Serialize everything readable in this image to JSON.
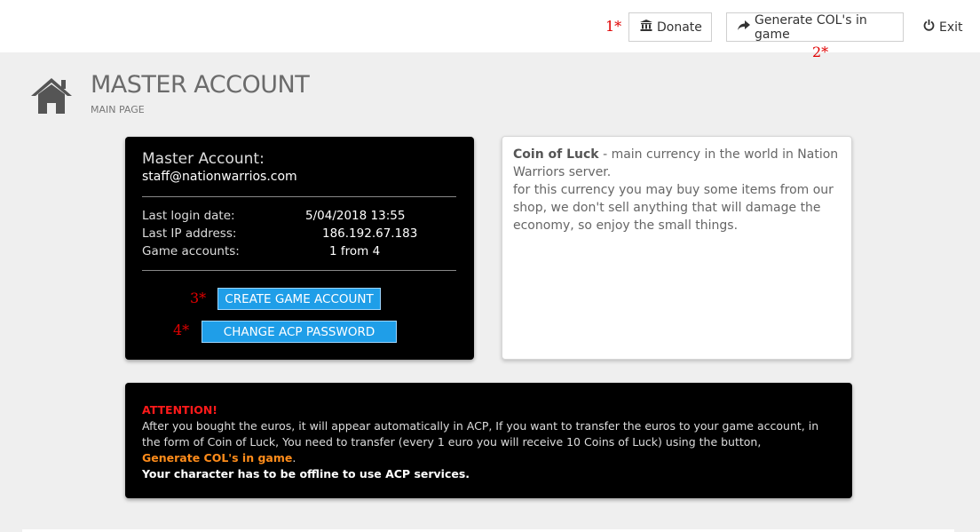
{
  "topbar": {
    "donate_label": "Donate",
    "generate_label": "Generate COL's in game",
    "exit_label": "Exit",
    "annotations": [
      "1*",
      "2*"
    ]
  },
  "page": {
    "title": "MASTER ACCOUNT",
    "subtitle": "MAIN PAGE"
  },
  "account": {
    "heading": "Master Account:",
    "email": "staff@nationwarrios.com",
    "rows": [
      {
        "label": "Last login date:",
        "value": "5/04/2018 13:55"
      },
      {
        "label": "Last IP address:",
        "value": "186.192.67.183"
      },
      {
        "label": "Game accounts:",
        "value": "1 from 4"
      }
    ],
    "create_button": "CREATE GAME ACCOUNT",
    "change_button": "CHANGE ACP PASSWORD",
    "annotations": [
      "3*",
      "4*"
    ]
  },
  "info": {
    "term": "Coin of Luck",
    "line1": " - main currency in the world in Nation Warriors server.",
    "line2": "for this currency you may buy some items from our shop, we don't sell anything that will damage the economy, so enjoy the small things."
  },
  "attention": {
    "heading": "ATTENTION!",
    "body": "After you bought the euros, it will appear automatically in ACP, If you want to transfer the euros to your game account, in the form of Coin of Luck, You need to transfer (every 1 euro you will receive 10 Coins of Luck) using the button,",
    "link_text": "Generate COL's in game",
    "link_suffix": ".",
    "warning": "Your character has to be offline to use ACP services."
  },
  "colors": {
    "accent_blue": "#1f9ee8",
    "attention_red": "#ff1a1a",
    "link_orange": "#ff8c1a",
    "annotation_red": "#e00000"
  }
}
